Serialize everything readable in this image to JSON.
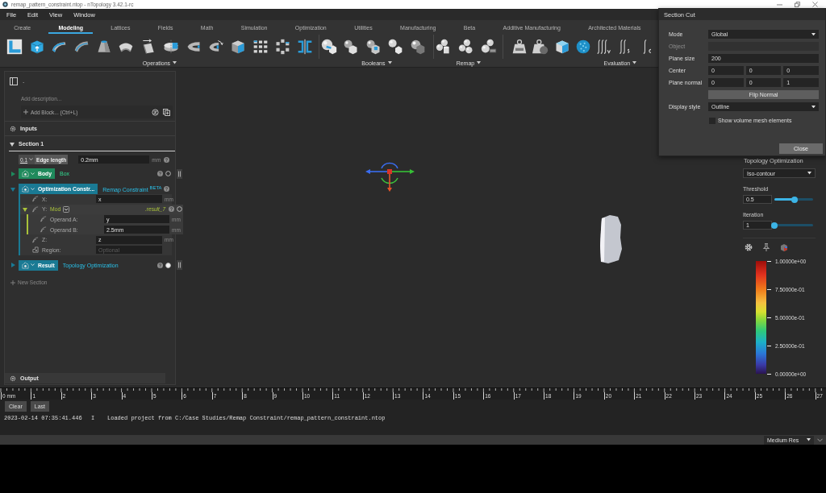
{
  "window": {
    "title": "remap_pattern_constraint.ntop - nTopology 3.42.1-rc"
  },
  "menu": [
    "File",
    "Edit",
    "View",
    "Window"
  ],
  "ribbon": {
    "tabs": [
      {
        "label": "Create",
        "selected": false
      },
      {
        "label": "Modeling",
        "selected": true
      },
      {
        "label": "Lattices",
        "selected": false
      },
      {
        "label": "Fields",
        "selected": false
      },
      {
        "label": "Math",
        "selected": false
      },
      {
        "label": "Simulation",
        "selected": false
      },
      {
        "label": "Optimization",
        "selected": false
      },
      {
        "label": "Utilities",
        "selected": false
      },
      {
        "label": "Manufacturing",
        "selected": false
      },
      {
        "label": "Beta",
        "selected": false
      },
      {
        "label": "Additive Manufacturing",
        "selected": false
      },
      {
        "label": "Architected Materials",
        "selected": false
      }
    ],
    "groups": [
      {
        "label": "Operations"
      },
      {
        "label": "Booleans"
      },
      {
        "label": "Remap"
      },
      {
        "label": "Evaluation"
      }
    ]
  },
  "notebook": {
    "title": ".",
    "description_placeholder": "Add description...",
    "add_block": "Add Block... (Ctrl+L)",
    "inputs": "Inputs",
    "sections": [
      {
        "title": "Section 1",
        "expanded": true,
        "blocks": [
          {
            "kind": "variable",
            "type": "0.1",
            "name": "Edge length",
            "value": "0.2mm",
            "unit": "mm"
          },
          {
            "kind": "block",
            "name": "Body",
            "type": "Box",
            "color": "#1f8a5c",
            "expanded": false,
            "shown": false
          },
          {
            "kind": "block",
            "name": "Optimization Constr...",
            "type": "Remap Constraint $^{BETA}$",
            "color": "#1a7a94",
            "expanded": true,
            "inputs": [
              {
                "kind": "field",
                "label": "X:",
                "value": "x",
                "unit": "mm"
              },
              {
                "kind": "operation",
                "label": "Y:",
                "operation": "Mod",
                "result": ".result_7",
                "expanded": true,
                "shown": false,
                "inputs": [
                  {
                    "kind": "field",
                    "label": "Operand A:",
                    "value": "y",
                    "unit": "mm"
                  },
                  {
                    "kind": "field",
                    "label": "Operand B:",
                    "value": "2.5mm",
                    "unit": "mm"
                  }
                ]
              },
              {
                "kind": "field",
                "label": "Z:",
                "value": "z",
                "unit": "mm"
              },
              {
                "kind": "region",
                "label": "Region:",
                "placeholder": "Optional"
              }
            ]
          },
          {
            "kind": "block",
            "name": "Result",
            "type": "Topology Optimization",
            "color": "#1a7a94",
            "expanded": false,
            "shown": true
          }
        ]
      }
    ],
    "new_section": "New Section",
    "output": "Output"
  },
  "section_cut": {
    "title": "Section Cut",
    "fields": [
      {
        "kind": "dropdown",
        "label": "Mode",
        "value": "Global"
      },
      {
        "kind": "text",
        "label": "Object",
        "disabled": true
      },
      {
        "kind": "text",
        "label": "Plane size",
        "value": "200",
        "disabled": false
      },
      {
        "kind": "vector",
        "label": "Center",
        "values": [
          "0",
          "0",
          "0"
        ]
      },
      {
        "kind": "vector",
        "label": "Plane normal",
        "values": [
          "0",
          "0",
          "1"
        ]
      },
      {
        "kind": "button",
        "label": "Flip Normal"
      },
      {
        "kind": "dropdown",
        "label": "Display style",
        "value": "Outline"
      },
      {
        "kind": "checkbox",
        "label": "Show volume mesh elements",
        "checked": false
      }
    ],
    "close_button": "Close"
  },
  "result_panel": {
    "title": "Topology Optimization",
    "display_mode": "Iso-contour",
    "sliders": [
      {
        "label": "Threshold",
        "value": "0.5",
        "level": 0.52
      },
      {
        "label": "Iteration",
        "value": "1",
        "level": 0
      }
    ],
    "legend": [
      "1.00000e+00",
      "7.50000e-01",
      "5.00000e-01",
      "2.50000e-01",
      "0.00000e+00"
    ]
  },
  "ruler": {
    "labels": [
      "0 mm",
      "1",
      "2",
      "3",
      "4",
      "5",
      "6",
      "7",
      "8",
      "9",
      "10",
      "11",
      "12",
      "13",
      "14",
      "15",
      "16",
      "17",
      "18",
      "19",
      "20",
      "21",
      "22",
      "23",
      "24",
      "25",
      "26",
      "27"
    ]
  },
  "console": {
    "buttons": [
      "Clear",
      "Last"
    ],
    "entries": [
      {
        "time": "2023-02-14 07:35:41.446",
        "level": "I",
        "message": "Loaded project from C:/Case Studies/Remap Constraint/remap_pattern_constraint.ntop"
      }
    ]
  },
  "status_bar": {
    "resolution": "Medium Res"
  }
}
